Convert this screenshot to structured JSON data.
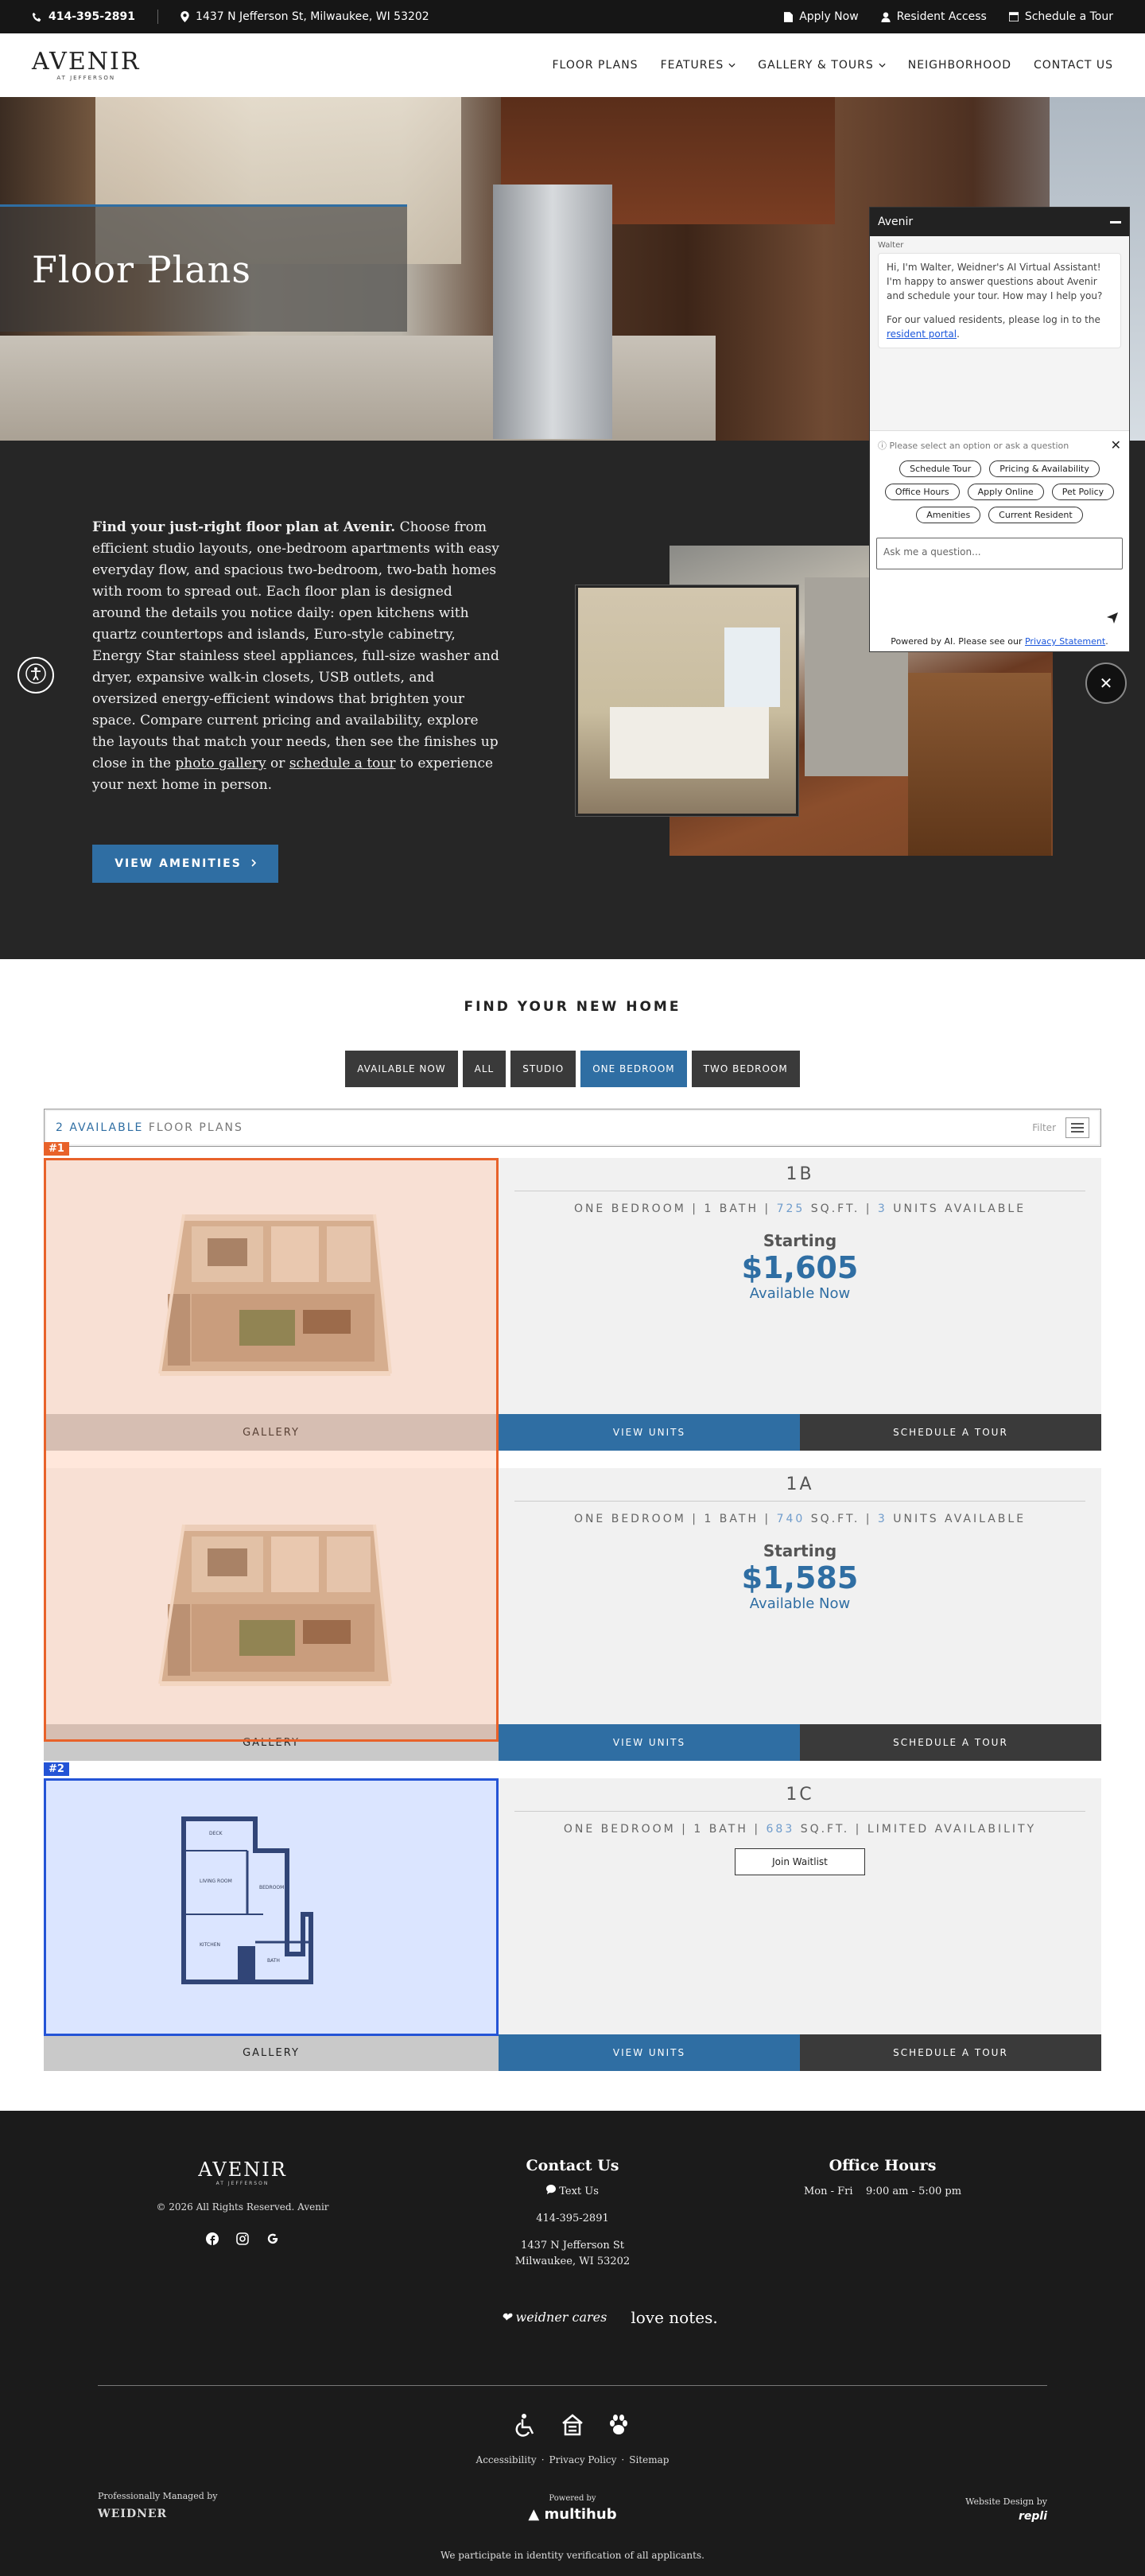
{
  "topbar": {
    "phone": "414-395-2891",
    "address": "1437 N Jefferson St, Milwaukee, WI 53202",
    "apply": "Apply Now",
    "resident": "Resident Access",
    "tour": "Schedule a Tour"
  },
  "header": {
    "logo_name": "AVENIR",
    "logo_sub": "AT JEFFERSON",
    "nav": [
      "FLOOR PLANS",
      "FEATURES",
      "GALLERY & TOURS",
      "NEIGHBORHOOD",
      "CONTACT US"
    ]
  },
  "hero": {
    "title": "Floor Plans"
  },
  "intro": {
    "lead": "Find your just-right floor plan at Avenir.",
    "body": " Choose from efficient studio layouts, one-bedroom apartments with easy everyday flow, and spacious two-bedroom, two-bath homes with room to spread out. Each floor plan is designed around the details you notice daily: open kitchens with quartz countertops and islands, Euro-style cabinetry, Energy Star stainless steel appliances, full-size washer and dryer, expansive walk-in closets, USB outlets, and oversized energy-efficient windows that brighten your space. Compare current pricing and availability, explore the layouts that match your needs, then see the finishes up close in the ",
    "link1": "photo gallery",
    "mid": " or ",
    "link2": "schedule a tour",
    "tail": " to experience your next home in person.",
    "button": "VIEW AMENITIES"
  },
  "chat": {
    "title": "Avenir",
    "agent": "Walter",
    "message": "Hi, I'm Walter, Weidner's AI Virtual Assistant! I'm happy to answer questions about Avenir and schedule your tour. How may I help you?",
    "resident_msg": "For our valued residents, please log in to the",
    "resident_link": "resident portal",
    "prompt": "Please select an option or ask a question",
    "options": [
      "Schedule Tour",
      "Pricing & Availability",
      "Office Hours",
      "Apply Online",
      "Pet Policy",
      "Amenities",
      "Current Resident"
    ],
    "input_placeholder": "Ask me a question...",
    "footer_text": "Powered by AI. Please see our",
    "footer_link": "Privacy Statement"
  },
  "find": {
    "title": "FIND YOUR NEW HOME",
    "filters": [
      "AVAILABLE NOW",
      "ALL",
      "STUDIO",
      "ONE BEDROOM",
      "TWO BEDROOM"
    ],
    "active_filter": "ONE BEDROOM",
    "available_count": "2 AVAILABLE",
    "available_label": "FLOOR PLANS",
    "filter_label": "Filter"
  },
  "plans": [
    {
      "name": "1B",
      "type": "ONE BEDROOM",
      "bath": "1 BATH",
      "sqft": "725",
      "sqft_unit": "SQ.FT.",
      "units": "3",
      "units_label": "UNITS AVAILABLE",
      "starting": "Starting",
      "price": "$1,605",
      "availability": "Available Now",
      "gallery": "GALLERY",
      "view_units": "VIEW UNITS",
      "tour": "SCHEDULE A TOUR"
    },
    {
      "name": "1A",
      "type": "ONE BEDROOM",
      "bath": "1 BATH",
      "sqft": "740",
      "sqft_unit": "SQ.FT.",
      "units": "3",
      "units_label": "UNITS AVAILABLE",
      "starting": "Starting",
      "price": "$1,585",
      "availability": "Available Now",
      "gallery": "GALLERY",
      "view_units": "VIEW UNITS",
      "tour": "SCHEDULE A TOUR"
    },
    {
      "name": "1C",
      "type": "ONE BEDROOM",
      "bath": "1 BATH",
      "sqft": "683",
      "sqft_unit": "SQ.FT.",
      "limited": "LIMITED AVAILABILITY",
      "waitlist": "Join Waitlist",
      "gallery": "GALLERY",
      "view_units": "VIEW UNITS",
      "tour": "SCHEDULE A TOUR",
      "room_labels": [
        "DECK",
        "LIVING ROOM",
        "BEDROOM",
        "KITCHEN",
        "BATH"
      ]
    }
  ],
  "annotations": {
    "tag1": "#1",
    "tag2": "#2"
  },
  "footer": {
    "logo_name": "AVENIR",
    "logo_sub": "AT JEFFERSON",
    "copyright": "© 2026 All Rights Reserved. Avenir",
    "contact_title": "Contact Us",
    "text_us": "Text Us",
    "phone": "414-395-2891",
    "street": "1437 N Jefferson St",
    "city": "Milwaukee, WI 53202",
    "hours_title": "Office Hours",
    "hours": "Mon - Fri    9:00 am - 5:00 pm",
    "partner1": "weidner cares",
    "partner2": "love notes.",
    "links": [
      "Accessibility",
      "Privacy Policy",
      "Sitemap"
    ],
    "managed_label": "Professionally Managed by",
    "managed_brand": "WEIDNER",
    "powered_label": "Powered by",
    "powered_brand": "multihub",
    "design_label": "Website Design by",
    "design_brand": "repli",
    "identity": "We participate in identity verification of all applicants."
  },
  "colors": {
    "accent": "#2f6ea3",
    "dark": "#262626",
    "tag1": "#e8622a",
    "tag2": "#2454d6"
  }
}
